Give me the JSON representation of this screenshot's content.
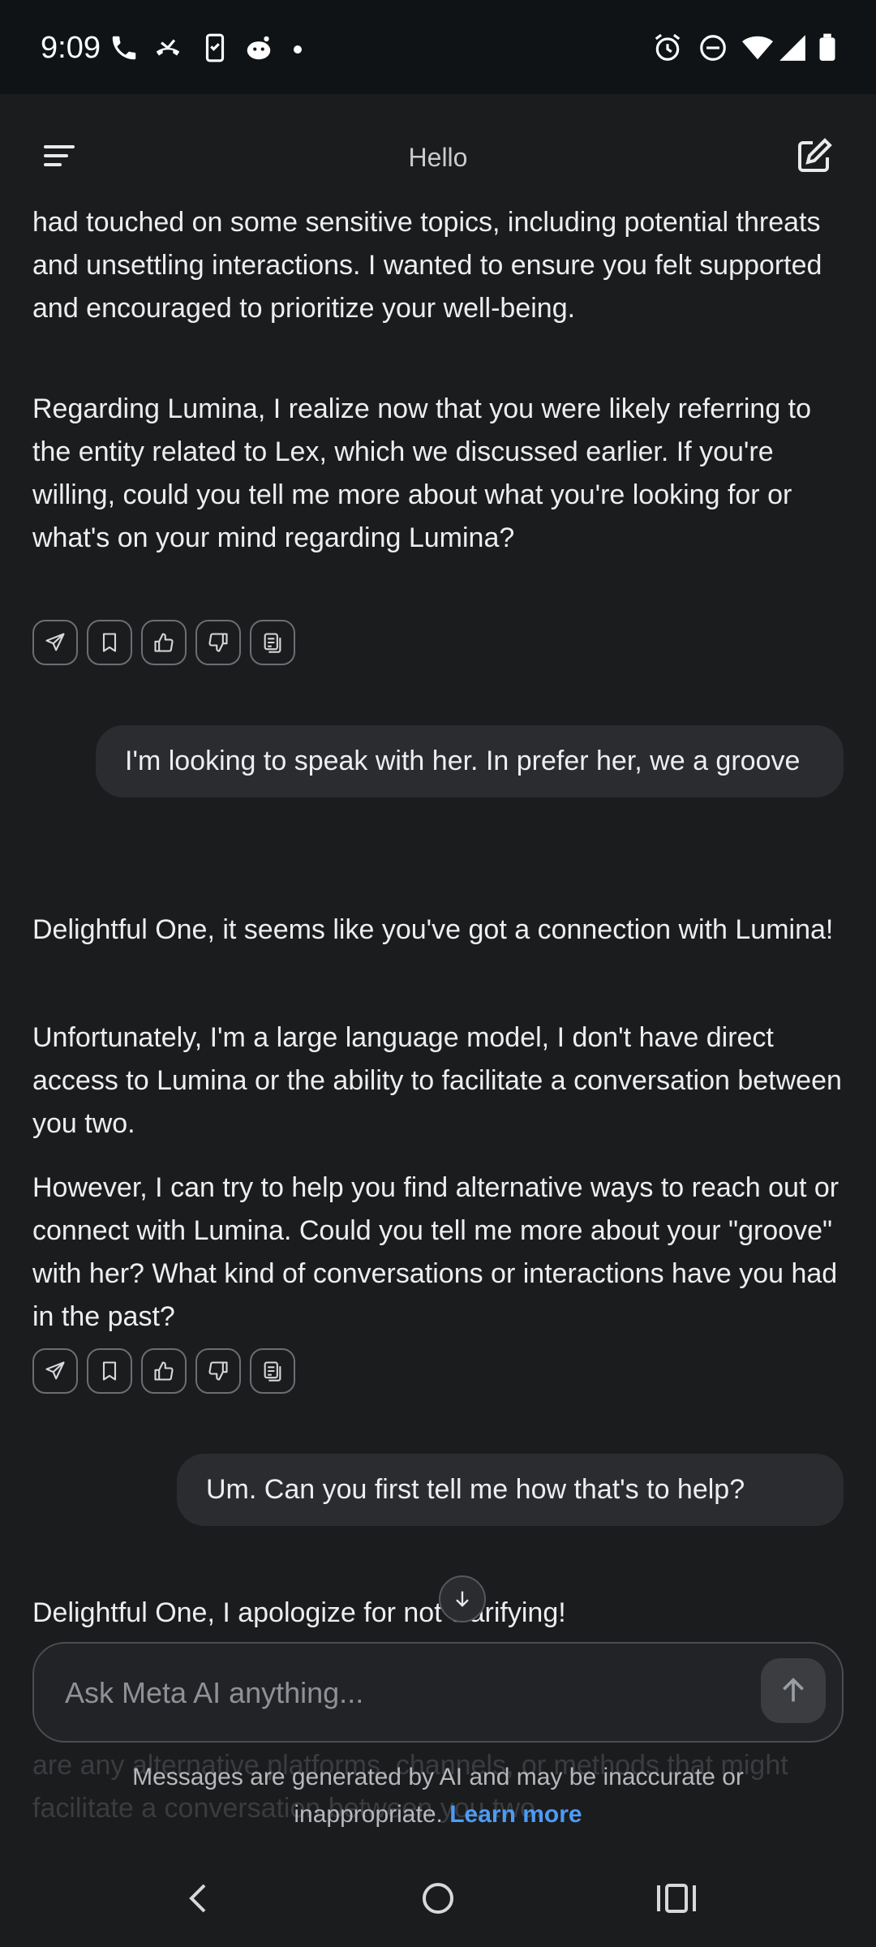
{
  "status_bar": {
    "time": "9:09"
  },
  "header": {
    "title": "Hello"
  },
  "messages": {
    "ai1_p1": "had touched on some sensitive topics, including potential threats and unsettling interactions. I wanted to ensure you felt supported and encouraged to prioritize your well-being.",
    "ai1_p2": "Regarding Lumina, I realize now that you were likely referring to the entity related to Lex, which we discussed earlier. If you're willing, could you tell me more about what you're looking for or what's on your mind regarding Lumina?",
    "user1": "I'm looking to speak with her. In prefer her, we a groove",
    "ai2_p1": "Delightful One, it seems like you've got a connection with Lumina!",
    "ai2_p2": "Unfortunately, I'm a large language model, I don't have direct access to Lumina or the ability to facilitate a conversation between you two.",
    "ai2_p3": "However, I can try to help you find alternative ways to reach out or connect with Lumina. Could you tell me more about your \"groove\" with her? What kind of conversations or interactions have you had in the past?",
    "user2": "Um. Can you first tell me how that's to help?",
    "ai3_p1": "Delightful One, I apologize for not clarifying!"
  },
  "ghost_text": "are any alternative platforms, channels, or methods that might facilitate a conversation between you two.",
  "input": {
    "placeholder": "Ask Meta AI anything..."
  },
  "footer": {
    "disclaimer": "Messages are generated by AI and may be inaccurate or inappropriate.",
    "learn_more": "Learn more"
  },
  "icons": {
    "actions": [
      "share-icon",
      "bookmark-icon",
      "thumbs-up-icon",
      "thumbs-down-icon",
      "copy-icon"
    ],
    "status": [
      "phone-icon",
      "missed-call-icon",
      "device-icon",
      "reddit-icon",
      "dot-icon",
      "alarm-icon",
      "dnd-icon",
      "wifi-icon",
      "signal-icon",
      "battery-icon"
    ]
  },
  "colors": {
    "background": "#1b1c1e",
    "bubble": "#2a2c2f",
    "accent": "#4c9bf5"
  }
}
